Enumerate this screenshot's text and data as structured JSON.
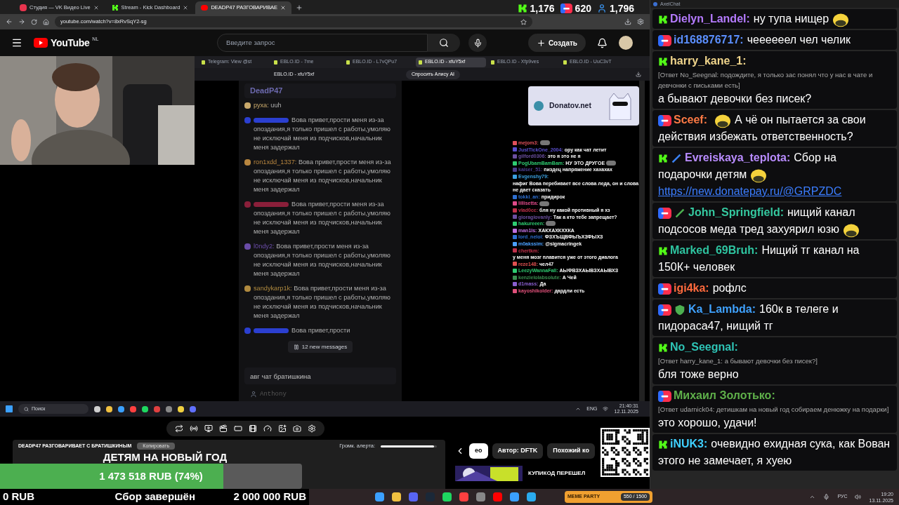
{
  "browser": {
    "tabs": [
      {
        "title": "Студия — VK Видео Live",
        "kind": "vk",
        "selected": false
      },
      {
        "title": "Stream - Kick Dashboard",
        "kind": "kick",
        "selected": false
      },
      {
        "title": "DEADP47 РАЗГОВАРИВАЕ",
        "kind": "youtube",
        "selected": true
      }
    ],
    "url": "youtube.com/watch?v=8xRvSqY2-sg",
    "stats": [
      {
        "kind": "kick",
        "value": "1,176"
      },
      {
        "kind": "vklive",
        "value": "620"
      },
      {
        "kind": "viewers",
        "value": "1,796"
      }
    ]
  },
  "youtube": {
    "logo_text": "YouTube",
    "logo_region": "NL",
    "search_placeholder": "Введите запрос",
    "create_label": "Создать"
  },
  "inner_browser": {
    "tabs": [
      {
        "title": "Telegram: View @st",
        "selected": false
      },
      {
        "title": "EBLO.ID - 7me",
        "selected": false
      },
      {
        "title": "EBLO.ID - L7vQPu7",
        "selected": false
      },
      {
        "title": "EBLO.ID - xfuY5xf",
        "selected": true
      },
      {
        "title": "EBLO.ID - Xfp9ves",
        "selected": false
      },
      {
        "title": "EBLO.ID - UuC3vT",
        "selected": false
      }
    ],
    "page_title": "EBLO.ID - xfuY5xf",
    "alice_label": "Спросить Алису AI"
  },
  "stream_chat": {
    "channel": "DeadP47",
    "messages": [
      {
        "name": "руха:",
        "color": "#c9a96b",
        "text": "uuh"
      },
      {
        "color": "#2b3fd0",
        "text": "Вова привет,прости меня из-за опоздания,я только пришел с работы,умоляю не исключай меня из подчисков,начальник меня задержал"
      },
      {
        "name": "ron1xdd_1337:",
        "color": "#b8863f",
        "text": "Вова привет,прости меня из-за опоздания,я только пришел с работы,умоляю не исключай меня из подчисков,начальник меня задержал"
      },
      {
        "color": "#8a1f3a",
        "text": "Вова привет,прости меня из-за опоздания,я только пришел с работы,умоляю не исключай меня из подчисков,начальник меня задержал"
      },
      {
        "name": "l0ndy2:",
        "color": "#6a4ca8",
        "text": "Вова привет,прости меня из-за опоздания,я только пришел с работы,умоляю не исключай меня из подчисков,начальник меня задержал"
      },
      {
        "name": "sandykarp1k:",
        "color": "#b08a3f",
        "text": "Вова привет,прости меня из-за опоздания,я только пришел с работы,умоляю не исключай меня из подчисков,начальник меня задержал"
      },
      {
        "color": "#2b3fd0",
        "text": "Вова привет,прости"
      }
    ],
    "new_messages": "12 new messages",
    "input_value": "авг чат братишкина",
    "user": "Anthony"
  },
  "overlay_chat": {
    "brand": "Donatov.net",
    "lines": [
      {
        "name": "mejom3:",
        "color": "#e0505a",
        "emote": true
      },
      {
        "name": "JustTickOne_2004:",
        "color": "#5a4fcf",
        "text": "ору как чат летит"
      },
      {
        "name": "gilford0306:",
        "color": "#6b4fa0",
        "text": "это я это не я"
      },
      {
        "name": "PogUbamBamBam:",
        "color": "#2ecc71",
        "text": "НУ ЭТО ДРУГОЕ",
        "emote": true
      },
      {
        "name": "kaiser_51:",
        "color": "#4b3f8f",
        "text": "пиздец напряжение хахахах"
      },
      {
        "name": "Evgenshy79:",
        "color": "#3aa0e0",
        "text": "нафиг Вова перебивает все слова леда, он и слова не дает сказать"
      },
      {
        "name": "tokki_an:",
        "color": "#2d6fd0",
        "text": "придирок"
      },
      {
        "name": "lillisetta:",
        "color": "#e04a8a",
        "emote": true
      },
      {
        "name": "vlad0cc:",
        "color": "#c0304a",
        "text": "бля ну какой противный я хз"
      },
      {
        "name": "gioragiovanly:",
        "color": "#6b4fa0",
        "text": "Так а кто тебе запрещает?"
      },
      {
        "name": "hakureeen:",
        "color": "#2ecc71",
        "emote": true
      },
      {
        "name": "man1ls:",
        "color": "#c070e0",
        "text": "ХАКХАХКХХКА"
      },
      {
        "name": "lord_neloi:",
        "color": "#2d6fd0",
        "text": "ФЗХЪЩВФЫЪХЗФЫХЗ"
      },
      {
        "name": "m0akssim:",
        "color": "#4aa0ff",
        "text": "@sigmacringek"
      },
      {
        "name": "chertkm:",
        "color": "#c0304a",
        "text": "у меня мозг плавится уже от этого диалога"
      },
      {
        "name": "reze148:",
        "color": "#e05050",
        "text": "чел47"
      },
      {
        "name": "LeezyWannaFall:",
        "color": "#2ecc71",
        "text": "АЫФВЗХАЫВЗХАЫВХЗ"
      },
      {
        "name": "kenzielolabsolute:",
        "color": "#3a8f50",
        "text": "А Чей"
      },
      {
        "name": "d1mass:",
        "color": "#8a5fd0",
        "text": "Да"
      },
      {
        "name": "kayoshikolder:",
        "color": "#e0507a",
        "text": "дардли есть"
      }
    ]
  },
  "inner_taskbar": {
    "search_placeholder": "Поиск",
    "language": "ENG",
    "time": "21:40:31",
    "date": "12.11.2025"
  },
  "stream_panel": {
    "title": "DEADP47 РАЗГОВАРИВАЕТ С БРАТИШКИНЫМ",
    "copy_label": "Копировать",
    "alert_volume_label": "Громк. алерта:",
    "alert_volume": {
      "level": 0.95
    }
  },
  "donation_goal": {
    "title": "ДЕТЯМ НА НОВЫЙ ГОД",
    "progress_text": "1 473 518 RUB (74%)",
    "level": 0.74,
    "min": "0 RUB",
    "status": "Сбор завершён",
    "max": "2 000 000 RUB"
  },
  "recommendations": {
    "chips": [
      {
        "label": "ео",
        "selected": true
      },
      {
        "label": "Автор: DFTK",
        "selected": false
      },
      {
        "label": "Похожий ко",
        "selected": false
      }
    ],
    "video_title": "КУПИКОД ПЕРЕШЕЛ"
  },
  "chat_window": {
    "title": "AxelChat",
    "messages": [
      {
        "kind": "kick",
        "name": "Dielyn_Landel:",
        "color": "#b57bff",
        "text": "ну тупа нищер",
        "emote_after": true
      },
      {
        "kind": "vklive",
        "name": "id168876717:",
        "color": "#5b8fff",
        "text": "чеееееел чел челик"
      },
      {
        "kind": "kick",
        "name": "harry_kane_1:",
        "color": "#f0d58c",
        "reply": "[Ответ No_Seegnal: подождите, я только зас понял что у нас в чате и девчонки с письками есть]",
        "text": "а бывают девочки без писек?"
      },
      {
        "kind": "vklive",
        "name": "Sceef:",
        "color": "#ff7a45",
        "text": "А чё он пытается за свои действия избежать ответственность?",
        "emote_before": true
      },
      {
        "kind": "kick",
        "badges": [
          {
            "kind": "sword",
            "color": "#3b82f6"
          }
        ],
        "name": "Evreiskaya_teplota:",
        "color": "#b98cff",
        "text": "Сбор на подарочки детям",
        "emote_after": true,
        "link": "https://new.donatepay.ru/@GRPZDC"
      },
      {
        "kind": "vklive",
        "badges": [
          {
            "kind": "sword",
            "color": "#4caf50"
          }
        ],
        "name": "John_Springfield:",
        "color": "#35c9a0",
        "text": "нищий канал подсосов меда тред захуярил юзю",
        "emote_after": true
      },
      {
        "kind": "kick",
        "name": "Marked_69Bruh:",
        "color": "#2ec4a0",
        "text": "Нищий тг канал на 150К+ человек"
      },
      {
        "kind": "vklive",
        "name": "igi4ka:",
        "color": "#ff6a3d",
        "text": "рофлс"
      },
      {
        "kind": "vklive",
        "badges": [
          {
            "kind": "shield",
            "color": "#4caf50"
          }
        ],
        "name": "Ka_Lambda:",
        "color": "#3fa2ff",
        "text": "160к в телеге и пидораса47, нищий тг"
      },
      {
        "kind": "kick",
        "name": "No_Seegnal:",
        "color": "#2ec4b6",
        "reply": "[Ответ harry_kane_1: а бывают девочки без писек?]",
        "text": "бля тоже верно"
      },
      {
        "kind": "vklive",
        "name": "Михаил Золотько:",
        "color": "#5fb04a",
        "reply": "[Ответ udarnick04: детишкам на новый год собираем денюжку на подарки]",
        "text": "это хорошо, удачи!"
      },
      {
        "kind": "kick",
        "name": "iNUK3:",
        "color": "#3fd0ff",
        "text": "очевидно ехидная сука, как Вован этого не замечает, я хуею"
      }
    ]
  },
  "taskbar": {
    "widget_title": "MEME PARTY",
    "widget_value": "550 / 1500",
    "language": "РУС",
    "time": "19:20",
    "date": "13.11.2025"
  }
}
